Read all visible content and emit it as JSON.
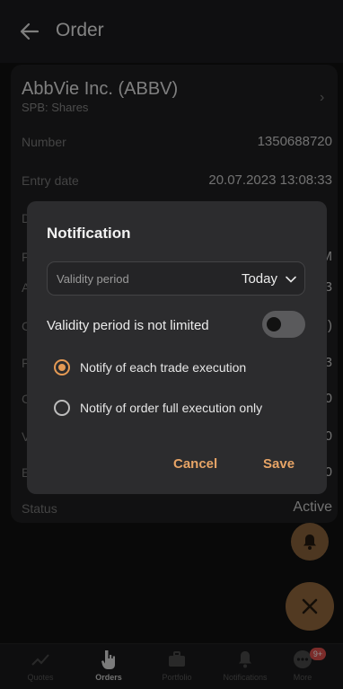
{
  "header": {
    "title": "Order"
  },
  "order": {
    "instrument_name": "AbbVie Inc. (ABBV)",
    "instrument_sub": "SPB: Shares",
    "rows": [
      {
        "label": "Number",
        "value": "1350688720"
      },
      {
        "label": "Entry date",
        "value": "20.07.2023 13:08:33"
      },
      {
        "label": "D",
        "value": ""
      },
      {
        "label": "F",
        "value": "M"
      },
      {
        "label": "A",
        "value": "3"
      },
      {
        "label": "C",
        "value": ")"
      },
      {
        "label": "F",
        "value": "3"
      },
      {
        "label": "C",
        "value": "0"
      },
      {
        "label": "V",
        "value": "0"
      },
      {
        "label": "E",
        "value": "0"
      },
      {
        "label": "Status",
        "value": "Active"
      }
    ]
  },
  "dialog": {
    "title": "Notification",
    "validity": {
      "label": "Validity period",
      "value": "Today"
    },
    "toggle_label": "Validity period is not limited",
    "toggle_on": false,
    "options": [
      {
        "label": "Notify of each trade execution",
        "selected": true
      },
      {
        "label": "Notify of order full execution only",
        "selected": false
      }
    ],
    "cancel_label": "Cancel",
    "save_label": "Save"
  },
  "bottom_nav": [
    {
      "label": "Quotes",
      "icon": "chart-line-icon",
      "active": false
    },
    {
      "label": "Orders",
      "icon": "hand-pointer-icon",
      "active": true
    },
    {
      "label": "Portfolio",
      "icon": "briefcase-icon",
      "active": false
    },
    {
      "label": "Notifications",
      "icon": "bell-icon",
      "active": false
    },
    {
      "label": "More",
      "icon": "more-dots-icon",
      "active": false,
      "badge": "9+"
    }
  ],
  "colors": {
    "accent": "#e59a54",
    "fab": "#b6814a",
    "badge": "#e0504d"
  }
}
